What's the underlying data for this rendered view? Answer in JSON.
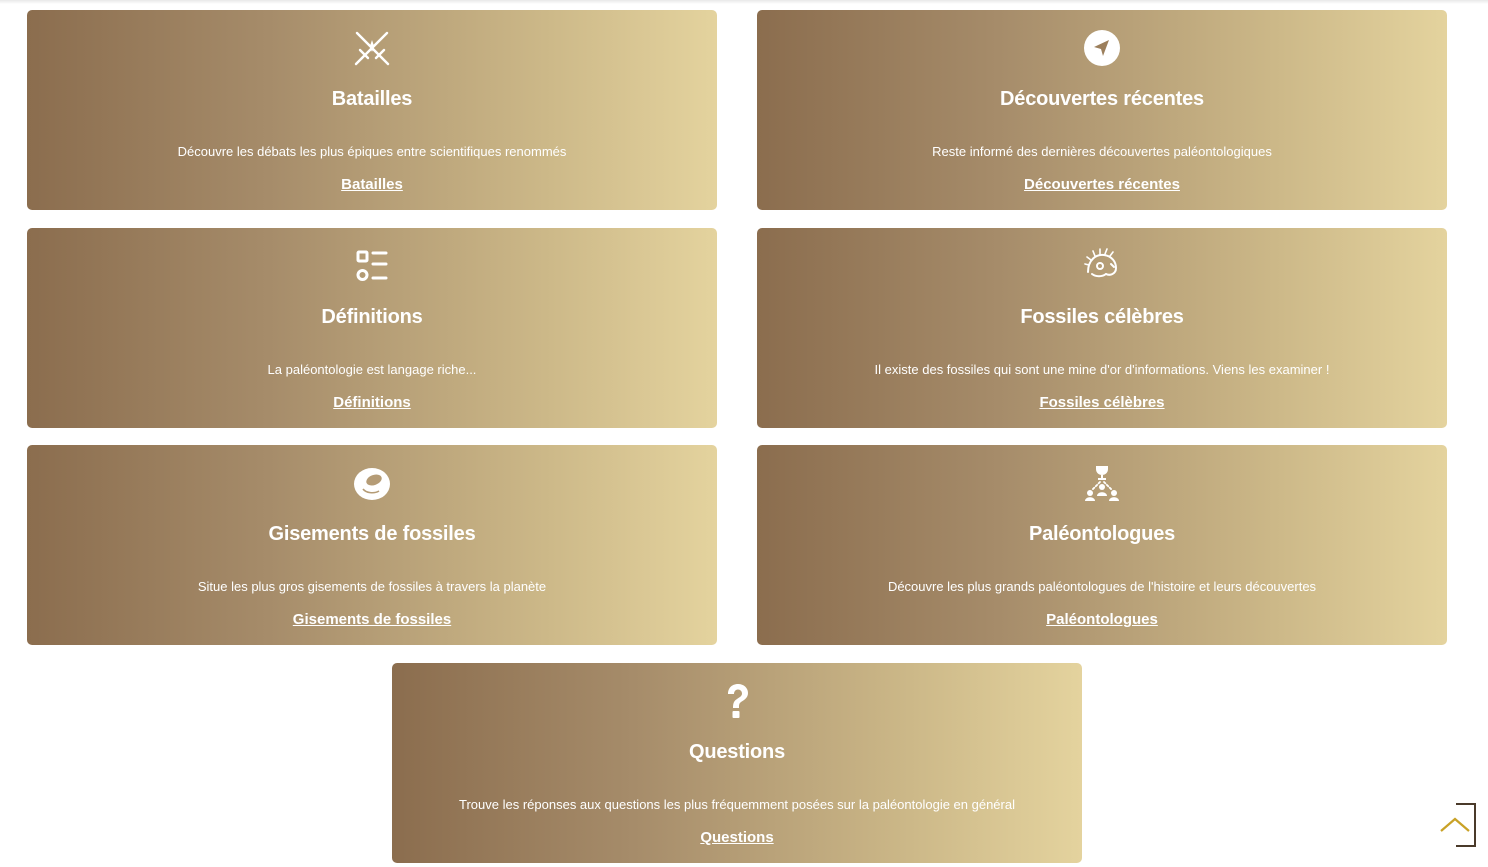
{
  "cards": [
    {
      "id": "batailles",
      "icon": "crossed-swords-icon",
      "title": "Batailles",
      "description": "Découvre les débats les plus épiques entre scientifiques renommés",
      "link": "Batailles"
    },
    {
      "id": "decouvertes",
      "icon": "location-arrow-icon",
      "title": "Découvertes récentes",
      "description": "Reste informé des dernières découvertes paléontologiques",
      "link": "Découvertes récentes"
    },
    {
      "id": "definitions",
      "icon": "list-shapes-icon",
      "title": "Définitions",
      "description": "La paléontologie est langage riche...",
      "link": "Définitions"
    },
    {
      "id": "fossiles",
      "icon": "dinosaur-head-icon",
      "title": "Fossiles célèbres",
      "description": "Il existe des fossiles qui sont une mine d'or d'informations. Viens les examiner !",
      "link": "Fossiles célèbres"
    },
    {
      "id": "gisements",
      "icon": "egg-icon",
      "title": "Gisements de fossiles",
      "description": "Situe les plus gros gisements de fossiles à travers la planète",
      "link": "Gisements de fossiles"
    },
    {
      "id": "paleontologues",
      "icon": "people-trophy-icon",
      "title": "Paléontologues",
      "description": "Découvre les plus grands paléontologues de l'histoire et leurs découvertes",
      "link": "Paléontologues"
    },
    {
      "id": "questions",
      "icon": "question-mark-icon",
      "title": "Questions",
      "description": "Trouve les réponses aux questions les plus fréquemment posées sur la paléontologie en général",
      "link": "Questions"
    }
  ],
  "scroll_top": {
    "icon": "chevron-up-icon"
  },
  "colors": {
    "gradient_start": "#8b6d4e",
    "gradient_end": "#e4d39e",
    "text": "#ffffff",
    "scroll_top_accent": "#c9a227"
  }
}
